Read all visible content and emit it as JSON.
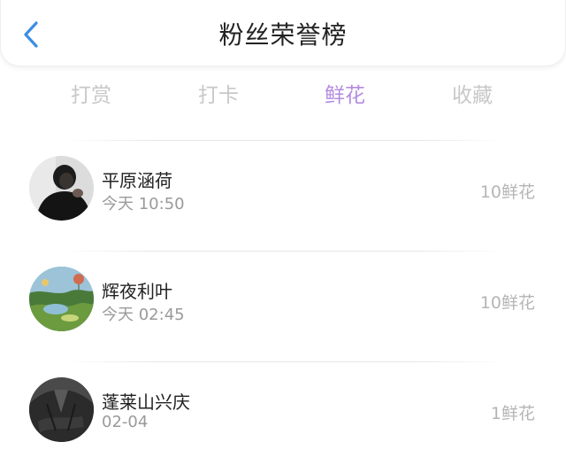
{
  "header": {
    "title": "粉丝荣誉榜",
    "back_icon": "chevron-left-icon",
    "accent_color": "#3a8ee6"
  },
  "tabs": [
    {
      "label": "打赏",
      "active": false
    },
    {
      "label": "打卡",
      "active": false
    },
    {
      "label": "鲜花",
      "active": true
    },
    {
      "label": "收藏",
      "active": false
    }
  ],
  "active_tab_color": "#b48ce0",
  "fans": [
    {
      "name": "平原涵荷",
      "time": "今天 10:50",
      "count": "10鲜花",
      "avatar": "dark-portrait"
    },
    {
      "name": "辉夜利叶",
      "time": "今天 02:45",
      "count": "10鲜花",
      "avatar": "landscape-balloons"
    },
    {
      "name": "蓬莱山兴庆",
      "time": "02-04",
      "count": "1鲜花",
      "avatar": "dark-suit"
    }
  ]
}
